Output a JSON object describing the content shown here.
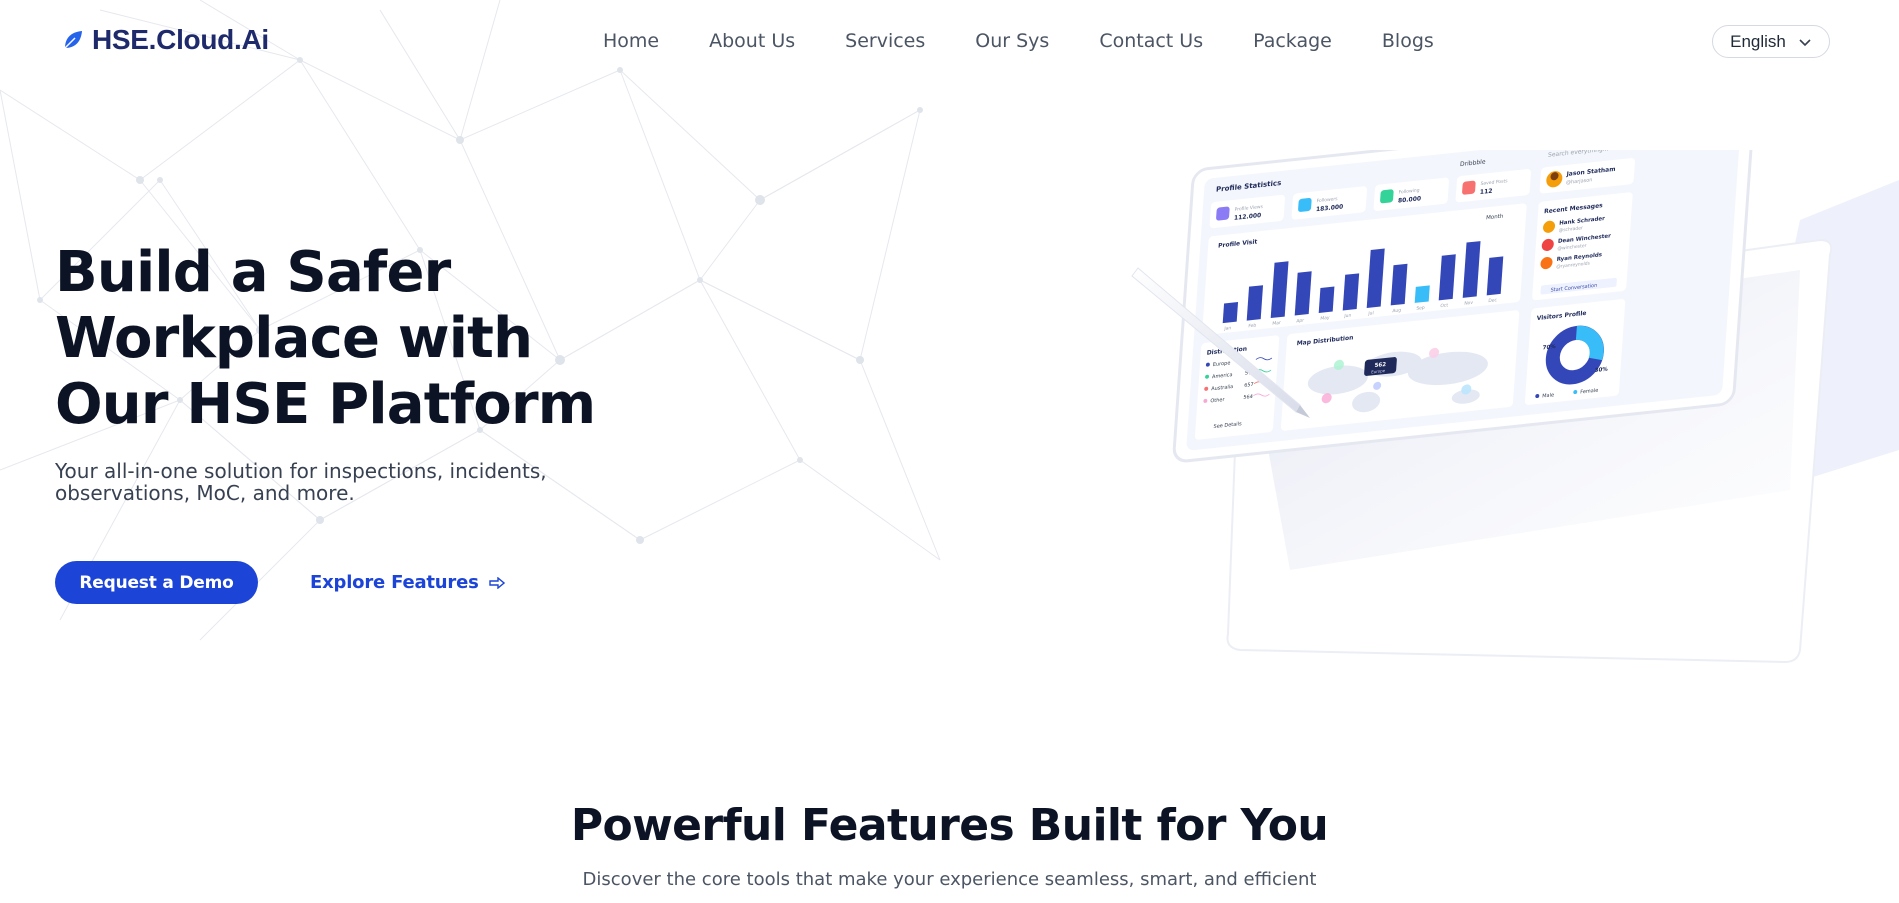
{
  "brand": {
    "name": "HSE.Cloud.Ai",
    "logo_icon": "leaf-icon",
    "accent": "#1c45d8"
  },
  "nav": {
    "items": [
      {
        "label": "Home"
      },
      {
        "label": "About Us"
      },
      {
        "label": "Services"
      },
      {
        "label": "Our Sys"
      },
      {
        "label": "Contact Us"
      },
      {
        "label": "Package"
      },
      {
        "label": "Blogs"
      }
    ],
    "language": {
      "selected": "English",
      "icon": "chevron-down-icon"
    }
  },
  "hero": {
    "title_line1": "Build a Safer",
    "title_line2": "Workplace with",
    "title_line3": "Our HSE Platform",
    "subtitle": "Your all-in-one solution for inspections, incidents, observations, MoC, and more.",
    "primary_cta": "Request a Demo",
    "secondary_cta": "Explore Features",
    "secondary_icon": "arrow-right-icon"
  },
  "dashboard_mockup": {
    "profile_statistics": "Profile Statistics",
    "dropdown": "Dribbble",
    "search_placeholder": "Search everything...",
    "stats": [
      {
        "label": "Profile Views",
        "value": "112.000",
        "color": "#8b7cf6"
      },
      {
        "label": "Followers",
        "value": "183.000",
        "color": "#38bdf8"
      },
      {
        "label": "Following",
        "value": "80.000",
        "color": "#34d399"
      },
      {
        "label": "Saved Posts",
        "value": "112",
        "color": "#f87171"
      }
    ],
    "user": {
      "name": "Jason Statham",
      "handle": "@harjason"
    },
    "profile_visit": "Profile Visit",
    "period": "Month",
    "bar_values": [
      22,
      38,
      62,
      48,
      28,
      40,
      65,
      45,
      18,
      50,
      62,
      42
    ],
    "months": [
      "Jan",
      "Feb",
      "Mar",
      "Apr",
      "May",
      "Jun",
      "Jul",
      "Aug",
      "Sep",
      "Oct",
      "Nov",
      "Dec"
    ],
    "recent_messages": "Recent Messages",
    "messages": [
      {
        "name": "Hank Schrader",
        "role": "@schrader"
      },
      {
        "name": "Dean Winchester",
        "role": "@winchester"
      },
      {
        "name": "Ryan Reynolds",
        "role": "@ryanreynolds"
      }
    ],
    "start_conversation": "Start Conversation",
    "distribution": "Distribution",
    "regions": [
      {
        "name": "Europe",
        "value": ""
      },
      {
        "name": "America",
        "value": "572"
      },
      {
        "name": "Australia",
        "value": "657"
      },
      {
        "name": "Other",
        "value": "564"
      }
    ],
    "see_details": "See Details",
    "map_distribution": "Map Distribution",
    "map_badge_value": "562",
    "map_badge_label": "Europe",
    "visitors_profile": "Visitors Profile",
    "visitors": {
      "male_pct": "70%",
      "female_pct": "30%",
      "male_label": "Male",
      "female_label": "Female"
    }
  },
  "features": {
    "title": "Powerful Features Built for You",
    "subtitle": "Discover the core tools that make your experience seamless, smart, and efficient"
  }
}
